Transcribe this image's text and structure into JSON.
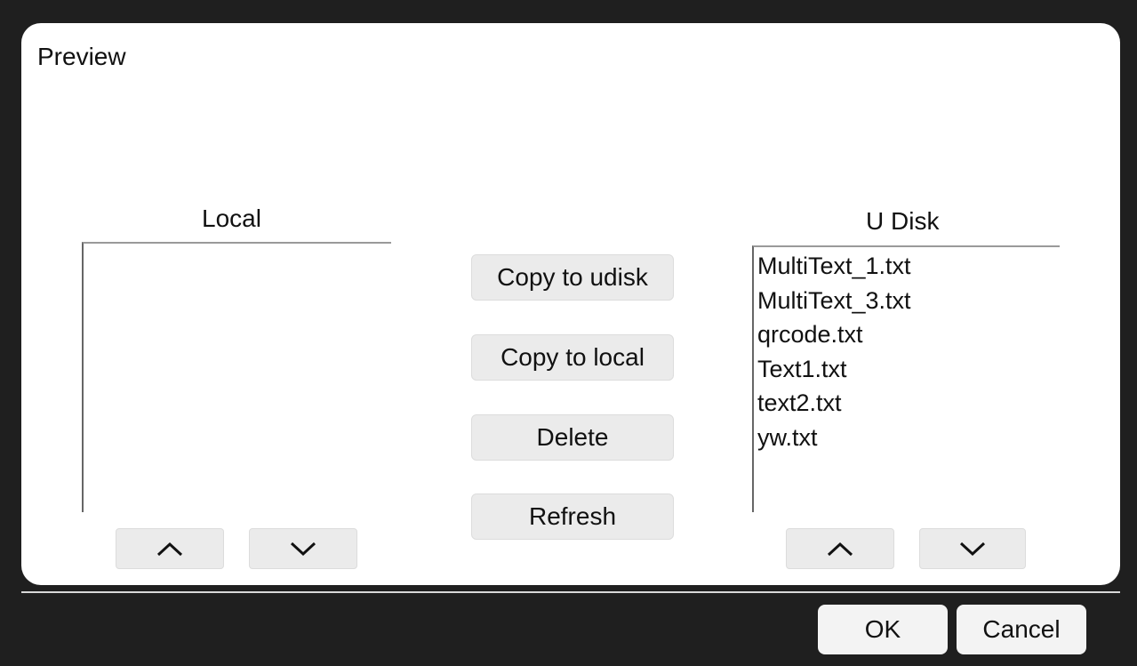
{
  "dialog": {
    "title": "Preview"
  },
  "local": {
    "label": "Local",
    "files": [],
    "up_icon": "chevron-up-icon",
    "down_icon": "chevron-down-icon"
  },
  "udisk": {
    "label": "U Disk",
    "files": [
      "MultiText_1.txt",
      "MultiText_3.txt",
      "qrcode.txt",
      "Text1.txt",
      "text2.txt",
      "yw.txt"
    ],
    "up_icon": "chevron-up-icon",
    "down_icon": "chevron-down-icon"
  },
  "actions": {
    "copy_to_udisk": "Copy to udisk",
    "copy_to_local": "Copy to local",
    "delete": "Delete",
    "refresh": "Refresh"
  },
  "footer": {
    "ok": "OK",
    "cancel": "Cancel"
  },
  "colors": {
    "frame": "#1f1f1f",
    "panel": "#ffffff",
    "button": "#ebebeb"
  }
}
